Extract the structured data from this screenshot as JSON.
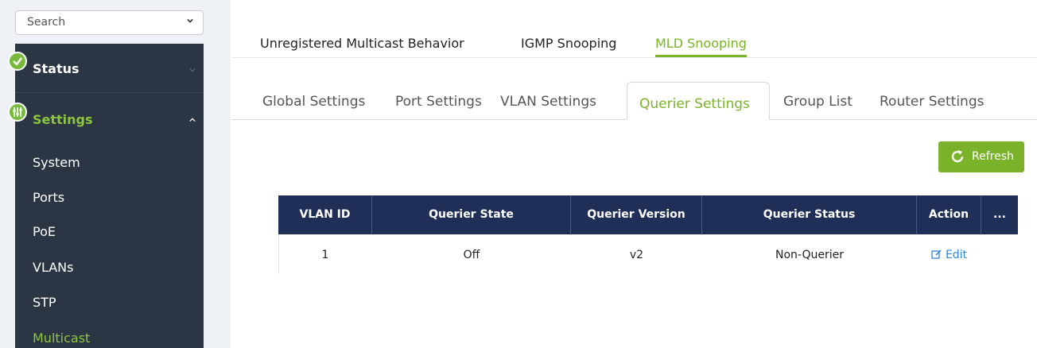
{
  "sidebar": {
    "search_label": "Search",
    "sections": [
      {
        "label": "Status",
        "icon": "check-icon",
        "expanded": false
      },
      {
        "label": "Settings",
        "icon": "sliders-icon",
        "expanded": true
      }
    ],
    "items": [
      {
        "label": "System",
        "active": false
      },
      {
        "label": "Ports",
        "active": false
      },
      {
        "label": "PoE",
        "active": false
      },
      {
        "label": "VLANs",
        "active": false
      },
      {
        "label": "STP",
        "active": false
      },
      {
        "label": "Multicast",
        "active": true
      }
    ],
    "colors": {
      "panel": "#2b3544",
      "accent": "#8cc63f"
    }
  },
  "top_tabs": [
    {
      "label": "Unregistered Multicast Behavior",
      "active": false
    },
    {
      "label": "IGMP Snooping",
      "active": false
    },
    {
      "label": "MLD Snooping",
      "active": true
    }
  ],
  "sub_tabs": [
    {
      "label": "Global Settings",
      "active": false
    },
    {
      "label": "Port Settings",
      "active": false
    },
    {
      "label": "VLAN Settings",
      "active": false
    },
    {
      "label": "Querier Settings",
      "active": true
    },
    {
      "label": "Group List",
      "active": false
    },
    {
      "label": "Router Settings",
      "active": false
    }
  ],
  "refresh_button": {
    "label": "Refresh",
    "icon": "refresh-icon"
  },
  "table": {
    "columns": [
      "VLAN ID",
      "Querier State",
      "Querier Version",
      "Querier Status",
      "Action",
      "..."
    ],
    "rows": [
      {
        "vlan_id": "1",
        "state": "Off",
        "version": "v2",
        "status": "Non-Querier",
        "action": "Edit"
      }
    ],
    "header_color": "#1f2f57"
  },
  "accent_color": "#7ab32a",
  "link_color": "#2f86d6"
}
